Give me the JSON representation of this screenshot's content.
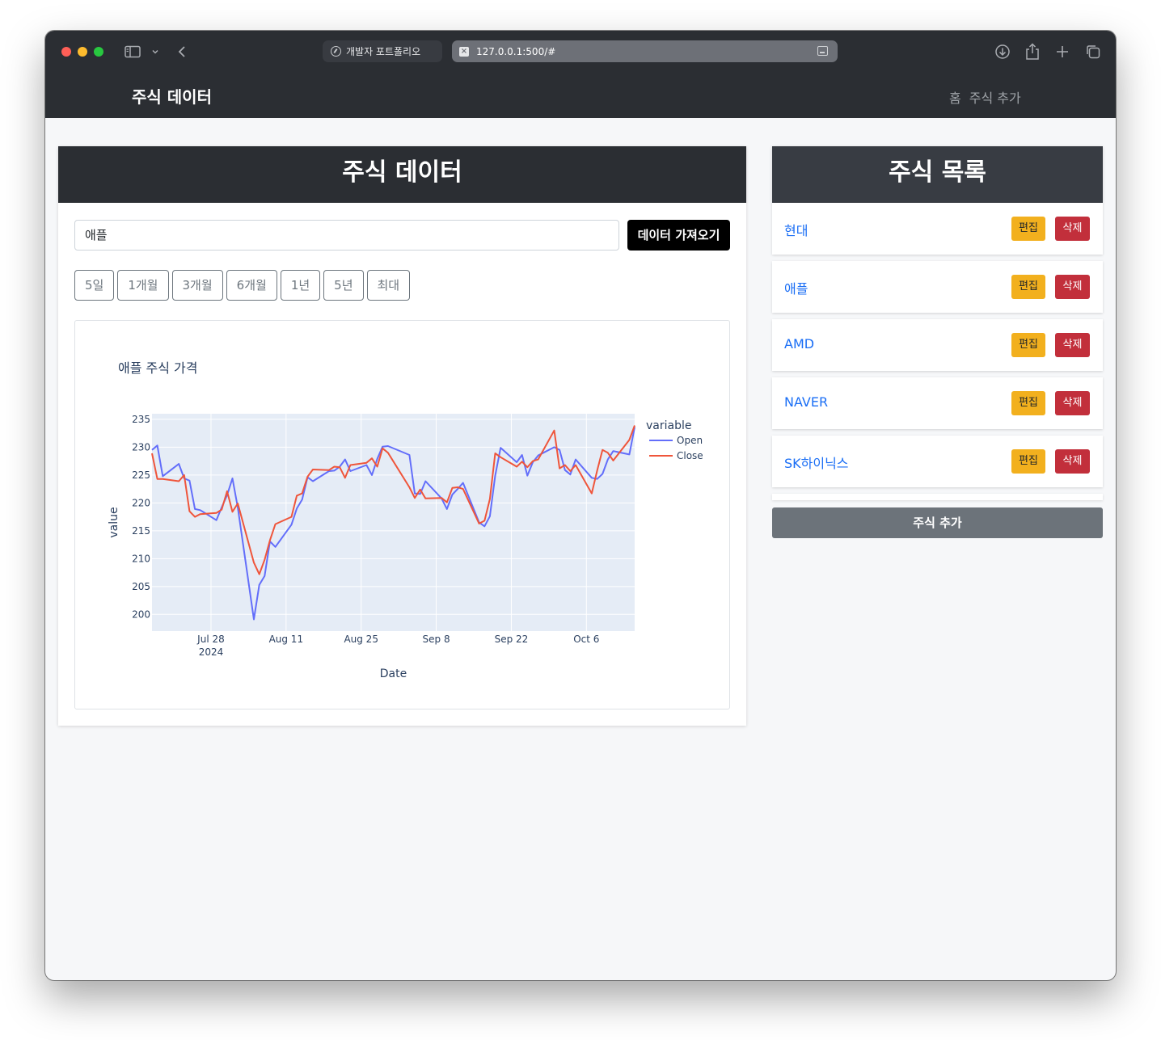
{
  "browser": {
    "tab_inactive_title": "개발자 포트폴리오",
    "tab_active_url": "127.0.0.1:500/#"
  },
  "navbar": {
    "brand": "주식 데이터",
    "links": [
      "홈",
      "주식 추가"
    ]
  },
  "main": {
    "title": "주식 데이터",
    "search_value": "애플",
    "fetch_label": "데이터 가져오기",
    "periods": [
      "5일",
      "1개월",
      "3개월",
      "6개월",
      "1년",
      "5년",
      "최대"
    ]
  },
  "sidebar": {
    "title": "주식 목록",
    "edit_label": "편집",
    "delete_label": "삭제",
    "stocks": [
      "현대",
      "애플",
      "AMD",
      "NAVER",
      "SK하이닉스"
    ],
    "add_label": "주식 추가"
  },
  "chart_data": {
    "type": "line",
    "title": "애플 주식 가격",
    "xlabel": "Date",
    "ylabel": "value",
    "legend_title": "variable",
    "legend_position": "right",
    "x_tick_labels": [
      "Jul 28\n2024",
      "Aug 11",
      "Aug 25",
      "Sep 8",
      "Sep 22",
      "Oct 6"
    ],
    "ylim": [
      197,
      236
    ],
    "y_ticks": [
      200,
      205,
      210,
      215,
      220,
      225,
      230,
      235
    ],
    "colors": {
      "Open": "#636efa",
      "Close": "#ef553b",
      "plot_bg": "#e5ecf6"
    },
    "series": [
      {
        "name": "Open",
        "x": [
          "2024-07-17",
          "2024-07-18",
          "2024-07-19",
          "2024-07-22",
          "2024-07-23",
          "2024-07-24",
          "2024-07-25",
          "2024-07-26",
          "2024-07-29",
          "2024-07-30",
          "2024-07-31",
          "2024-08-01",
          "2024-08-02",
          "2024-08-05",
          "2024-08-06",
          "2024-08-07",
          "2024-08-08",
          "2024-08-09",
          "2024-08-12",
          "2024-08-13",
          "2024-08-14",
          "2024-08-15",
          "2024-08-16",
          "2024-08-19",
          "2024-08-20",
          "2024-08-21",
          "2024-08-22",
          "2024-08-23",
          "2024-08-26",
          "2024-08-27",
          "2024-08-28",
          "2024-08-29",
          "2024-08-30",
          "2024-09-03",
          "2024-09-04",
          "2024-09-05",
          "2024-09-06",
          "2024-09-09",
          "2024-09-10",
          "2024-09-11",
          "2024-09-12",
          "2024-09-13",
          "2024-09-16",
          "2024-09-17",
          "2024-09-18",
          "2024-09-19",
          "2024-09-20",
          "2024-09-23",
          "2024-09-24",
          "2024-09-25",
          "2024-09-26",
          "2024-09-27",
          "2024-09-30",
          "2024-10-01",
          "2024-10-02",
          "2024-10-03",
          "2024-10-04",
          "2024-10-07",
          "2024-10-08",
          "2024-10-09",
          "2024-10-10",
          "2024-10-11",
          "2024-10-14",
          "2024-10-15"
        ],
        "values": [
          229.5,
          230.3,
          224.8,
          227.0,
          224.4,
          224.0,
          218.9,
          218.7,
          216.9,
          219.2,
          221.4,
          224.4,
          219.2,
          199.1,
          205.3,
          206.9,
          213.1,
          212.1,
          216.1,
          219.0,
          220.6,
          224.6,
          223.9,
          225.7,
          225.8,
          226.5,
          227.8,
          225.7,
          226.8,
          225.0,
          227.9,
          230.1,
          230.2,
          228.6,
          221.7,
          221.6,
          223.9,
          220.8,
          218.9,
          221.5,
          222.5,
          223.6,
          216.5,
          215.8,
          217.6,
          224.9,
          229.9,
          227.3,
          228.6,
          224.9,
          227.3,
          228.5,
          230.0,
          229.5,
          225.9,
          225.1,
          227.8,
          224.5,
          224.3,
          225.2,
          227.8,
          229.3,
          228.7,
          233.6
        ]
      },
      {
        "name": "Close",
        "x": [
          "2024-07-17",
          "2024-07-18",
          "2024-07-19",
          "2024-07-22",
          "2024-07-23",
          "2024-07-24",
          "2024-07-25",
          "2024-07-26",
          "2024-07-29",
          "2024-07-30",
          "2024-07-31",
          "2024-08-01",
          "2024-08-02",
          "2024-08-05",
          "2024-08-06",
          "2024-08-07",
          "2024-08-08",
          "2024-08-09",
          "2024-08-12",
          "2024-08-13",
          "2024-08-14",
          "2024-08-15",
          "2024-08-16",
          "2024-08-19",
          "2024-08-20",
          "2024-08-21",
          "2024-08-22",
          "2024-08-23",
          "2024-08-26",
          "2024-08-27",
          "2024-08-28",
          "2024-08-29",
          "2024-08-30",
          "2024-09-03",
          "2024-09-04",
          "2024-09-05",
          "2024-09-06",
          "2024-09-09",
          "2024-09-10",
          "2024-09-11",
          "2024-09-12",
          "2024-09-13",
          "2024-09-16",
          "2024-09-17",
          "2024-09-18",
          "2024-09-19",
          "2024-09-20",
          "2024-09-23",
          "2024-09-24",
          "2024-09-25",
          "2024-09-26",
          "2024-09-27",
          "2024-09-30",
          "2024-10-01",
          "2024-10-02",
          "2024-10-03",
          "2024-10-04",
          "2024-10-07",
          "2024-10-08",
          "2024-10-09",
          "2024-10-10",
          "2024-10-11",
          "2024-10-14",
          "2024-10-15"
        ],
        "values": [
          228.9,
          224.3,
          224.3,
          223.9,
          225.0,
          218.5,
          217.5,
          218.0,
          218.2,
          218.8,
          222.1,
          218.4,
          219.9,
          209.3,
          207.2,
          209.8,
          213.3,
          216.2,
          217.5,
          221.3,
          221.7,
          224.7,
          226.0,
          225.9,
          226.5,
          226.4,
          224.5,
          226.8,
          227.2,
          228.0,
          226.5,
          229.8,
          229.0,
          222.8,
          220.9,
          222.4,
          220.8,
          220.9,
          220.1,
          222.7,
          222.8,
          222.5,
          216.3,
          216.8,
          220.7,
          228.9,
          228.2,
          226.5,
          227.4,
          226.4,
          227.5,
          227.8,
          233.0,
          226.2,
          226.8,
          225.7,
          226.8,
          221.7,
          225.8,
          229.5,
          229.0,
          227.6,
          231.3,
          233.9
        ]
      }
    ]
  }
}
